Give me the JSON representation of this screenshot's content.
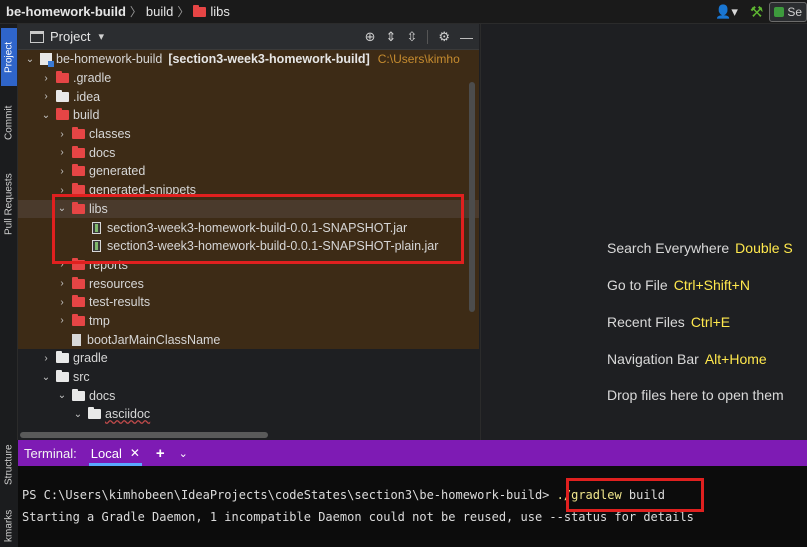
{
  "navbar": {
    "project": "be-homework-build",
    "build": "build",
    "libs": "libs",
    "run_label": "Se"
  },
  "left_tabs": {
    "project": "Project",
    "commit": "Commit",
    "pull_requests": "Pull Requests",
    "structure": "Structure",
    "bookmarks": "kmarks"
  },
  "project_window": {
    "title": "Project"
  },
  "tree": [
    {
      "id": "root",
      "name": "be-homework-build",
      "branch": "[section3-week3-homework-build]",
      "path": "C:\\Users\\kimho"
    },
    {
      "id": "gradle-dot",
      "name": ".gradle"
    },
    {
      "id": "idea",
      "name": ".idea"
    },
    {
      "id": "build",
      "name": "build"
    },
    {
      "id": "classes",
      "name": "classes"
    },
    {
      "id": "docs",
      "name": "docs"
    },
    {
      "id": "generated",
      "name": "generated"
    },
    {
      "id": "generated-snippets",
      "name": "generated-snippets"
    },
    {
      "id": "libs",
      "name": "libs"
    },
    {
      "id": "jar1",
      "name": "section3-week3-homework-build-0.0.1-SNAPSHOT.jar"
    },
    {
      "id": "jar2",
      "name": "section3-week3-homework-build-0.0.1-SNAPSHOT-plain.jar"
    },
    {
      "id": "reports",
      "name": "reports"
    },
    {
      "id": "resources",
      "name": "resources"
    },
    {
      "id": "test-results",
      "name": "test-results"
    },
    {
      "id": "tmp",
      "name": "tmp"
    },
    {
      "id": "bootjar",
      "name": "bootJarMainClassName"
    },
    {
      "id": "gradle",
      "name": "gradle"
    },
    {
      "id": "src",
      "name": "src"
    },
    {
      "id": "src-docs",
      "name": "docs"
    },
    {
      "id": "asciidoc",
      "name": "asciidoc"
    }
  ],
  "editor_hints": [
    {
      "label": "Search Everywhere",
      "keys": "Double S"
    },
    {
      "label": "Go to File",
      "keys": "Ctrl+Shift+N"
    },
    {
      "label": "Recent Files",
      "keys": "Ctrl+E"
    },
    {
      "label": "Navigation Bar",
      "keys": "Alt+Home"
    },
    {
      "label": "Drop files here to open them",
      "keys": ""
    }
  ],
  "terminal": {
    "label": "Terminal:",
    "tab": "Local",
    "prompt": "PS C:\\Users\\kimhobeen\\IdeaProjects\\codeStates\\section3\\be-homework-build>",
    "command": "./gradlew",
    "command_arg": "build",
    "line2": "Starting a Gradle Daemon, 1 incompatible Daemon could not be reused, use --status for details"
  },
  "colors": {
    "accent": "#2f65ca",
    "terminal_header": "#7e1bb4",
    "highlight_box": "#e0201f",
    "key_hint": "#ffe84d",
    "excluded_folder_bg": "#3d2b16"
  }
}
